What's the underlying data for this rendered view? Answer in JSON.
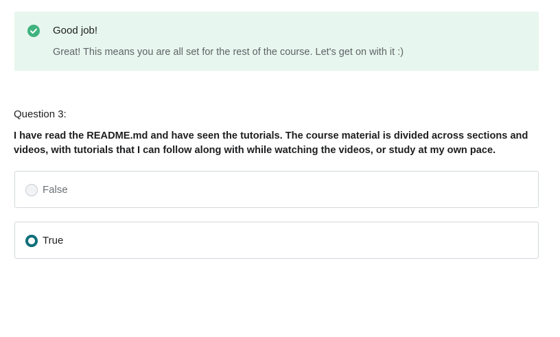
{
  "feedback": {
    "icon": "check-circle-icon",
    "title": "Good job!",
    "message": "Great! This means you are all set for the rest of the course. Let's get on with it :)",
    "background_color": "#e7f6ee",
    "icon_color": "#3fb27f"
  },
  "question": {
    "number_label": "Question 3:",
    "text": "I have read the README.md and have seen the tutorials. The course material is divided across sections and videos, with tutorials that I can follow along with while watching the videos, or study at my own pace.",
    "options": [
      {
        "label": "False",
        "selected": false
      },
      {
        "label": "True",
        "selected": true
      }
    ],
    "selected_color": "#0f6f79"
  }
}
